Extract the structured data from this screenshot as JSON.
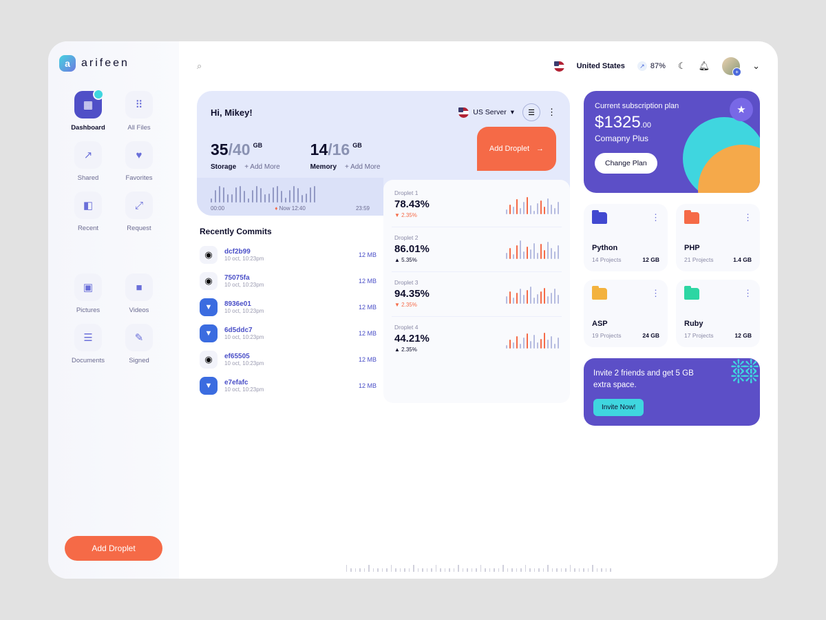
{
  "brand": {
    "name": "arifeen"
  },
  "topbar": {
    "region": "United States",
    "trend_pct": "87%",
    "chevron": "⌄"
  },
  "sidebar": {
    "items": [
      {
        "label": "Dashboard",
        "glyph": "▦"
      },
      {
        "label": "All Files",
        "glyph": "⠿"
      },
      {
        "label": "Shared",
        "glyph": "↗"
      },
      {
        "label": "Favorites",
        "glyph": "♥"
      },
      {
        "label": "Recent",
        "glyph": "◧"
      },
      {
        "label": "Request",
        "glyph": "⤢"
      },
      {
        "label": "Pictures",
        "glyph": "▣"
      },
      {
        "label": "Videos",
        "glyph": "■"
      },
      {
        "label": "Documents",
        "glyph": "☰"
      },
      {
        "label": "Signed",
        "glyph": "✎"
      }
    ],
    "cta": "Add Droplet"
  },
  "hero": {
    "greeting": "Hi, Mikey!",
    "server": "US Server",
    "storage": {
      "used": "35",
      "total": "40",
      "unit": "GB",
      "label": "Storage",
      "add": "+ Add More"
    },
    "memory": {
      "used": "14",
      "total": "16",
      "unit": "GB",
      "label": "Memory",
      "add": "+ Add More"
    },
    "add_btn": "Add Droplet",
    "timeline": {
      "start": "00:00",
      "now": "Now 12:40",
      "end": "23:59"
    }
  },
  "commits": {
    "title": "Recently Commits",
    "rows": [
      {
        "hash": "dcf2b99",
        "time": "10 oct, 10:23pm",
        "size": "12 MB",
        "src": "gh"
      },
      {
        "hash": "75075fa",
        "time": "10 oct, 10:23pm",
        "size": "12 MB",
        "src": "gh"
      },
      {
        "hash": "8936e01",
        "time": "10 oct, 10:23pm",
        "size": "12 MB",
        "src": "bb"
      },
      {
        "hash": "6d5ddc7",
        "time": "10 oct, 10:23pm",
        "size": "12 MB",
        "src": "bb"
      },
      {
        "hash": "ef65505",
        "time": "10 oct, 10:23pm",
        "size": "12 MB",
        "src": "gh"
      },
      {
        "hash": "e7efafc",
        "time": "10 oct, 10:23pm",
        "size": "12 MB",
        "src": "bb"
      }
    ]
  },
  "droplets": [
    {
      "name": "Droplet 1",
      "pct": "78.43%",
      "delta": "2.35%",
      "dir": "down"
    },
    {
      "name": "Droplet 2",
      "pct": "86.01%",
      "delta": "5.35%",
      "dir": "up"
    },
    {
      "name": "Droplet 3",
      "pct": "94.35%",
      "delta": "2.35%",
      "dir": "down"
    },
    {
      "name": "Droplet 4",
      "pct": "44.21%",
      "delta": "2.35%",
      "dir": "up"
    }
  ],
  "subscription": {
    "title": "Current subscription plan",
    "amount": "$1325",
    "cents": ".00",
    "plan": "Comapny Plus",
    "cta": "Change Plan"
  },
  "folders": [
    {
      "name": "Python",
      "projects": "14 Projects",
      "size": "12 GB",
      "color": "#4249d0"
    },
    {
      "name": "PHP",
      "projects": "21 Projects",
      "size": "1.4 GB",
      "color": "#f56a47"
    },
    {
      "name": "ASP",
      "projects": "19 Projects",
      "size": "24 GB",
      "color": "#f3b23e"
    },
    {
      "name": "Ruby",
      "projects": "17 Projects",
      "size": "12 GB",
      "color": "#2dd6a3"
    }
  ],
  "invite": {
    "text": "Invite 2 friends and get 5 GB extra space.",
    "cta": "Invite Now!"
  },
  "chart_data": {
    "type": "bar",
    "title": "Droplet activity sparklines",
    "series": [
      {
        "name": "Droplet 1",
        "values": [
          4,
          8,
          6,
          12,
          5,
          10,
          14,
          7,
          3,
          9,
          11,
          6,
          13,
          8,
          5,
          10
        ]
      },
      {
        "name": "Droplet 2",
        "values": [
          5,
          9,
          4,
          11,
          15,
          6,
          10,
          8,
          13,
          5,
          12,
          7,
          14,
          9,
          6,
          11
        ]
      },
      {
        "name": "Droplet 3",
        "values": [
          6,
          10,
          5,
          9,
          12,
          7,
          11,
          14,
          5,
          8,
          10,
          13,
          6,
          9,
          12,
          7
        ]
      },
      {
        "name": "Droplet 4",
        "values": [
          3,
          7,
          5,
          10,
          4,
          9,
          12,
          6,
          11,
          5,
          8,
          13,
          7,
          10,
          4,
          9
        ]
      }
    ],
    "ylim": [
      0,
      16
    ]
  }
}
